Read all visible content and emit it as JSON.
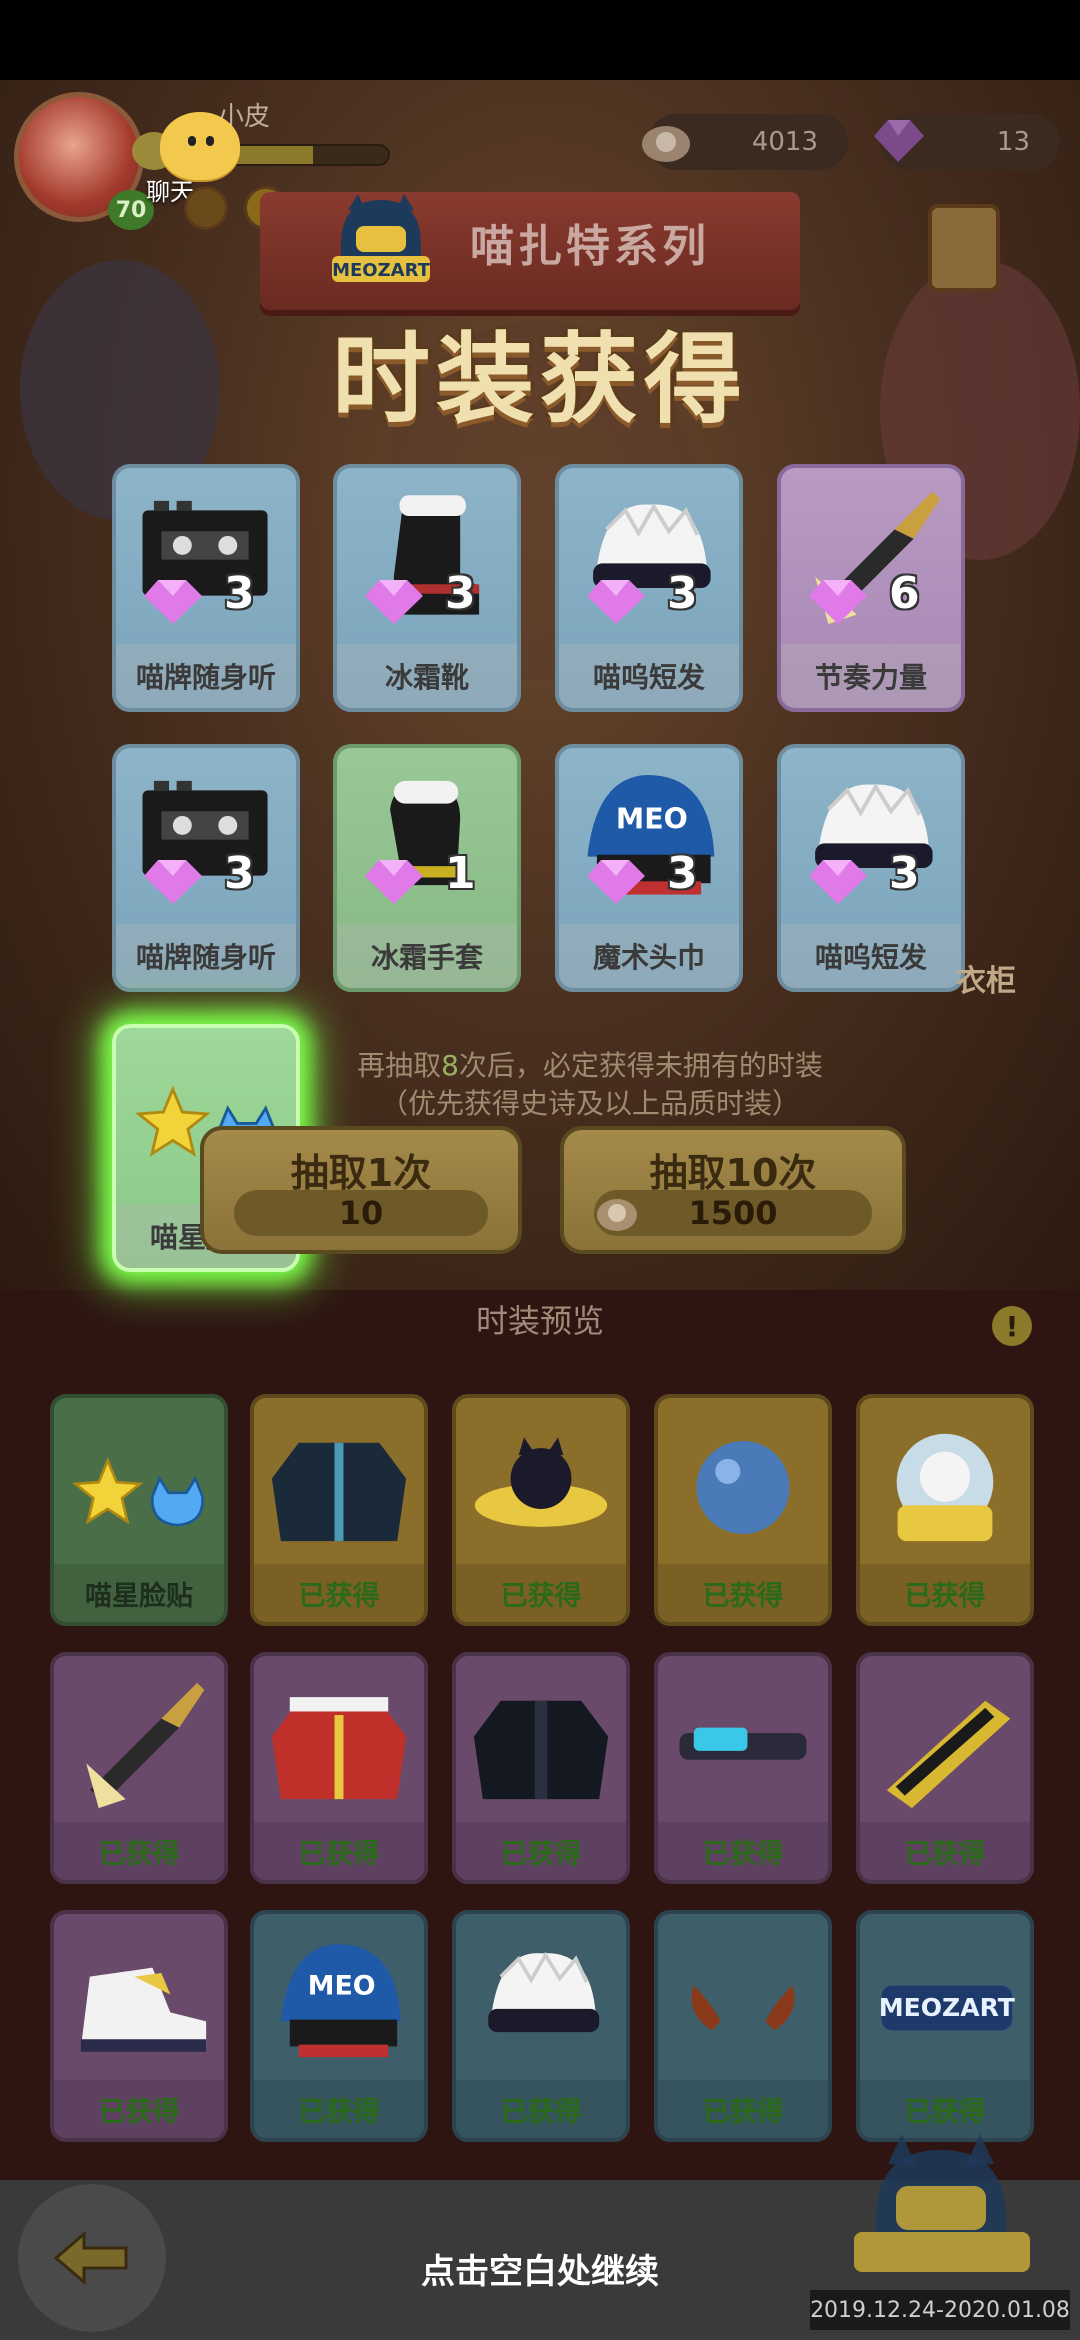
{
  "header": {
    "player_name": "小皮",
    "level": "70",
    "chat_label": "聊天",
    "xp_fraction": 0.55,
    "coins": "4013",
    "gems": "13"
  },
  "banner": {
    "series_title": "喵扎特系列",
    "main_title": "时装获得"
  },
  "rewards": [
    {
      "name": "喵牌随身听",
      "count": "3",
      "rarity": "blue",
      "icon": "cassette-player-icon"
    },
    {
      "name": "冰霜靴",
      "count": "3",
      "rarity": "blue",
      "icon": "boot-icon"
    },
    {
      "name": "喵呜短发",
      "count": "3",
      "rarity": "blue",
      "icon": "white-hair-icon"
    },
    {
      "name": "节奏力量",
      "count": "6",
      "rarity": "purple",
      "icon": "guitar-icon"
    },
    {
      "name": "喵牌随身听",
      "count": "3",
      "rarity": "blue",
      "icon": "cassette-player-icon"
    },
    {
      "name": "冰霜手套",
      "count": "1",
      "rarity": "green",
      "icon": "glove-icon"
    },
    {
      "name": "魔术头巾",
      "count": "3",
      "rarity": "blue",
      "icon": "bandana-icon"
    },
    {
      "name": "喵呜短发",
      "count": "3",
      "rarity": "blue",
      "icon": "white-hair-icon"
    },
    {
      "name": "喵星脸贴",
      "count": "",
      "rarity": "green-glow",
      "icon": "face-sticker-icon"
    }
  ],
  "draw": {
    "hint_line1_prefix": "再抽取",
    "hint_line1_number": "8",
    "hint_line1_suffix": "次后，必定获得未拥有的时装",
    "hint_line2": "（优先获得史诗及以上品质时装）",
    "single_label": "抽取1次",
    "single_cost": "10",
    "ten_label": "抽取10次",
    "ten_cost": "1500"
  },
  "wardrobe_label": "衣柜",
  "preview": {
    "title": "时装预览",
    "items": [
      {
        "label": "喵星脸贴",
        "color": "green",
        "icon": "face-sticker-icon"
      },
      {
        "label": "已获得",
        "color": "gold",
        "icon": "jacket-icon"
      },
      {
        "label": "已获得",
        "color": "gold",
        "icon": "ufo-cat-icon"
      },
      {
        "label": "已获得",
        "color": "gold",
        "icon": "blue-ball-icon"
      },
      {
        "label": "已获得",
        "color": "gold",
        "icon": "cat-capsule-icon"
      },
      {
        "label": "已获得",
        "color": "purple",
        "icon": "guitar-icon"
      },
      {
        "label": "已获得",
        "color": "purple",
        "icon": "red-coat-icon"
      },
      {
        "label": "已获得",
        "color": "purple",
        "icon": "black-jacket-icon"
      },
      {
        "label": "已获得",
        "color": "purple",
        "icon": "visor-glasses-icon"
      },
      {
        "label": "已获得",
        "color": "purple",
        "icon": "keytar-icon"
      },
      {
        "label": "已获得",
        "color": "purple",
        "icon": "sneaker-icon"
      },
      {
        "label": "已获得",
        "color": "blue",
        "icon": "bandana-icon"
      },
      {
        "label": "已获得",
        "color": "blue",
        "icon": "white-hair-icon"
      },
      {
        "label": "已获得",
        "color": "blue",
        "icon": "antlers-icon"
      },
      {
        "label": "已获得",
        "color": "blue",
        "icon": "meozart-logo-icon"
      }
    ]
  },
  "footer": {
    "continue_text": "点击空白处继续",
    "date_range": "2019.12.24-2020.01.08"
  },
  "colors": {
    "glow": "#7dff4a",
    "obtained_text": "#2a6a1a"
  }
}
